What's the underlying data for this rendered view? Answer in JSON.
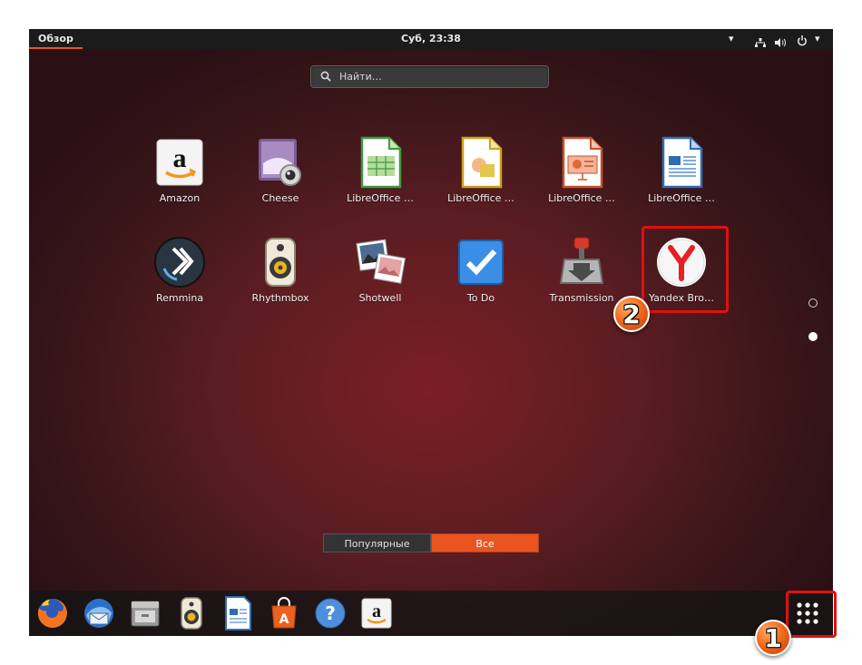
{
  "topbar": {
    "overview_label": "Обзор",
    "clock": "Суб, 23:38",
    "icons": [
      "dropdown-arrow-icon",
      "network-icon",
      "volume-icon",
      "power-icon",
      "menu-arrow-icon"
    ]
  },
  "search": {
    "placeholder": "Найти…"
  },
  "apps": [
    {
      "label": "Amazon",
      "icon": "amazon-icon"
    },
    {
      "label": "Cheese",
      "icon": "cheese-webcam-icon"
    },
    {
      "label": "LibreOffice …",
      "icon": "libreoffice-calc-icon"
    },
    {
      "label": "LibreOffice …",
      "icon": "libreoffice-draw-icon"
    },
    {
      "label": "LibreOffice …",
      "icon": "libreoffice-impress-icon"
    },
    {
      "label": "LibreOffice …",
      "icon": "libreoffice-writer-icon"
    },
    {
      "label": "Remmina",
      "icon": "remmina-icon"
    },
    {
      "label": "Rhythmbox",
      "icon": "rhythmbox-speaker-icon"
    },
    {
      "label": "Shotwell",
      "icon": "shotwell-photos-icon"
    },
    {
      "label": "To Do",
      "icon": "todo-checkmark-icon"
    },
    {
      "label": "Transmission",
      "icon": "transmission-icon"
    },
    {
      "label": "Yandex Bro…",
      "icon": "yandex-browser-icon"
    }
  ],
  "switcher": {
    "frequent_label": "Популярные",
    "all_label": "Все",
    "active": "all"
  },
  "dock": [
    "firefox-icon",
    "thunderbird-icon",
    "files-icon",
    "rhythmbox-icon",
    "writer-icon",
    "software-center-icon",
    "help-icon",
    "amazon-icon"
  ],
  "annotations": {
    "step1": "1",
    "step2": "2"
  },
  "colors": {
    "accent": "#e9541f",
    "highlight": "#e01010"
  }
}
